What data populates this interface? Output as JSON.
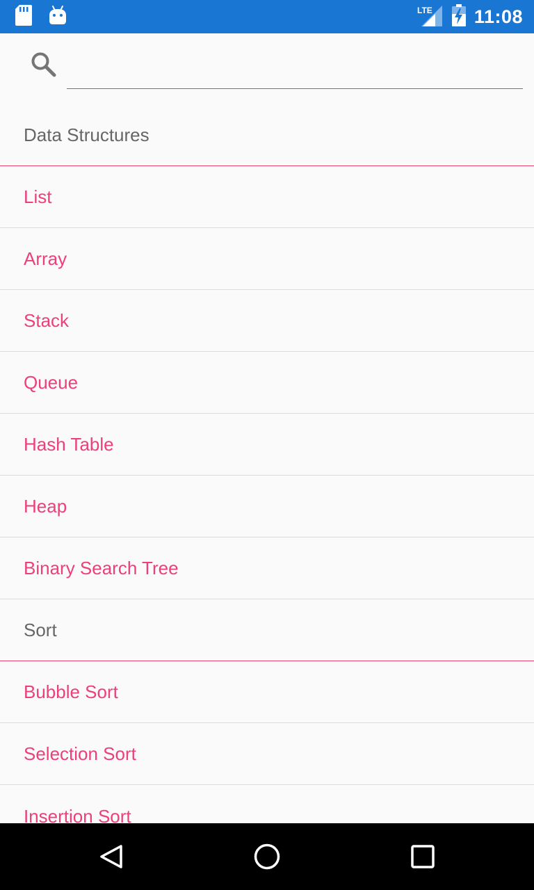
{
  "status_bar": {
    "time": "11:08",
    "network": "LTE",
    "background_color": "#1976d2",
    "icons": [
      "sd-card-icon",
      "android-icon",
      "signal-icon",
      "battery-icon"
    ]
  },
  "search": {
    "value": "",
    "placeholder": "",
    "icon": "search-icon"
  },
  "list": {
    "accent_color": "#ec407a",
    "sections": [
      {
        "header": "Data Structures",
        "items": [
          "List",
          "Array",
          "Stack",
          "Queue",
          "Hash Table",
          "Heap",
          "Binary Search Tree"
        ]
      },
      {
        "header": "Sort",
        "items": [
          "Bubble Sort",
          "Selection Sort",
          "Insertion Sort"
        ]
      }
    ]
  },
  "nav_bar": {
    "buttons": [
      "back-icon",
      "home-icon",
      "recents-icon"
    ]
  }
}
